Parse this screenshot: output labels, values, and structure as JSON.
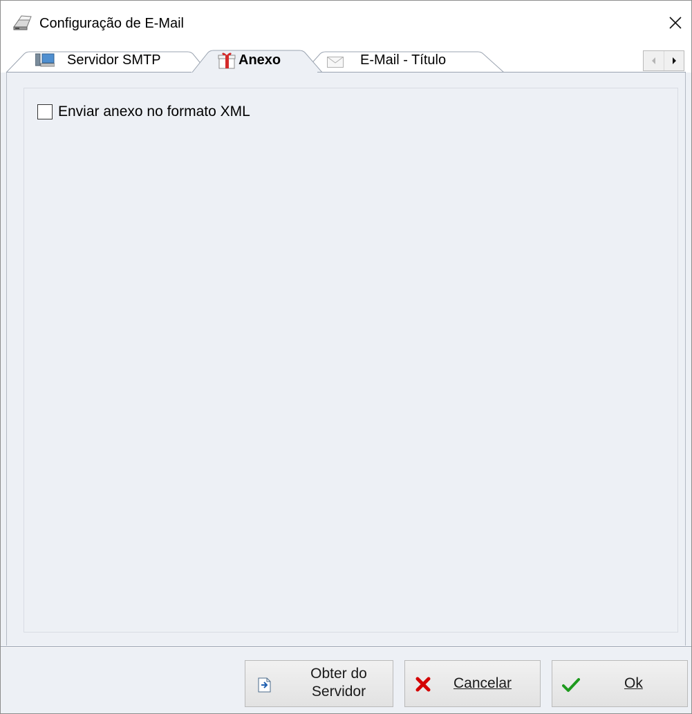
{
  "window": {
    "title": "Configuração de E-Mail",
    "close_glyph": "✕"
  },
  "tabs": [
    {
      "label": "Servidor SMTP",
      "icon": "computer-icon",
      "active": false
    },
    {
      "label": "Anexo",
      "icon": "gift-icon",
      "active": true
    },
    {
      "label": "E-Mail - Título",
      "icon": "envelope-icon",
      "active": false
    }
  ],
  "tab_scroll": {
    "left_glyph": "◂",
    "right_glyph": "▸"
  },
  "anexo": {
    "checkbox_label": "Enviar anexo no formato XML",
    "checked": false
  },
  "buttons": {
    "obter_line1": "Obter do",
    "obter_line2": "Servidor",
    "cancelar": "Cancelar",
    "ok": "Ok"
  },
  "colors": {
    "background": "#edf0f5",
    "cancel_icon": "#d40000",
    "ok_icon": "#1e9a1e"
  }
}
